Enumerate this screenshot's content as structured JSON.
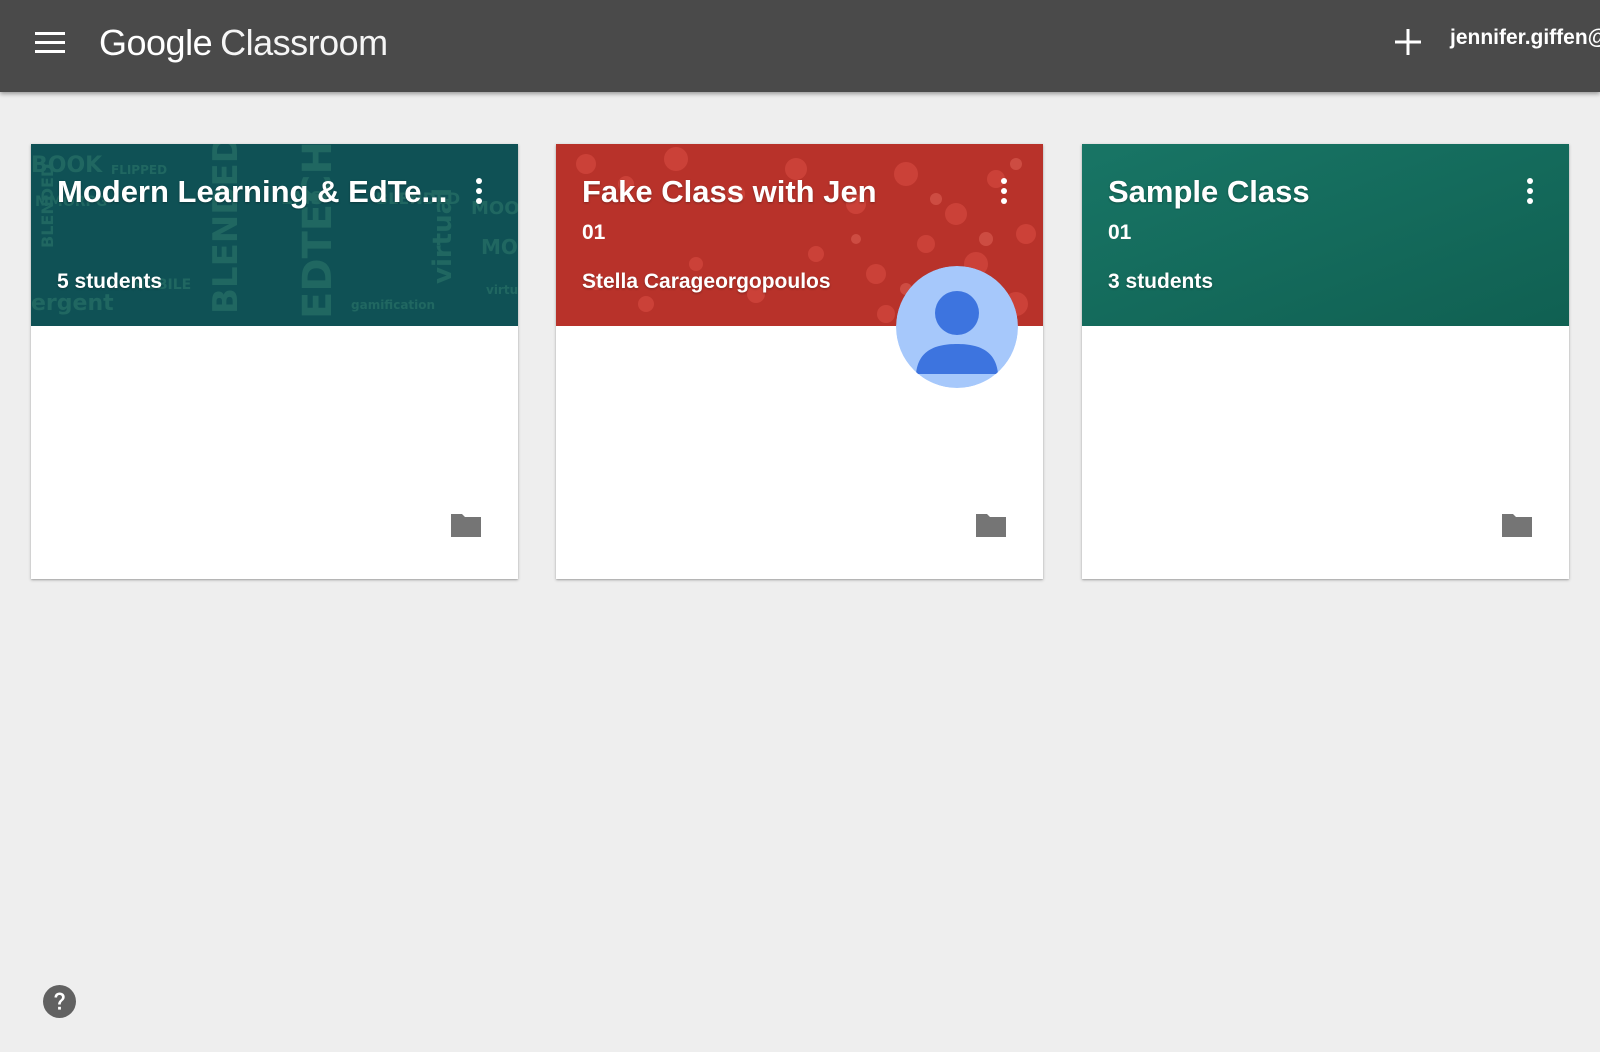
{
  "header": {
    "brand_google": "Google",
    "brand_product": "Classroom",
    "account": "jennifer.giffen@",
    "menu_icon": "hamburger-menu-icon",
    "add_icon": "plus-icon"
  },
  "colors": {
    "appbar": "#4a4a4a",
    "background": "#eeeeee",
    "card1_header": "#0f5155",
    "card2_header": "#b8322a",
    "card3_header": "#146b5c",
    "avatar_bg": "#a6c8fb",
    "avatar_fg": "#3d74df"
  },
  "cards": [
    {
      "title": "Modern Learning & EdTe...",
      "section": "",
      "subtitle": "5 students",
      "folder_icon": "folder-icon"
    },
    {
      "title": "Fake Class with Jen",
      "section": "01",
      "subtitle": "Stella Carageorgopoulos",
      "folder_icon": "folder-icon"
    },
    {
      "title": "Sample Class",
      "section": "01",
      "subtitle": "3 students",
      "folder_icon": "folder-icon"
    }
  ],
  "footer": {
    "help_icon": "help-icon"
  }
}
